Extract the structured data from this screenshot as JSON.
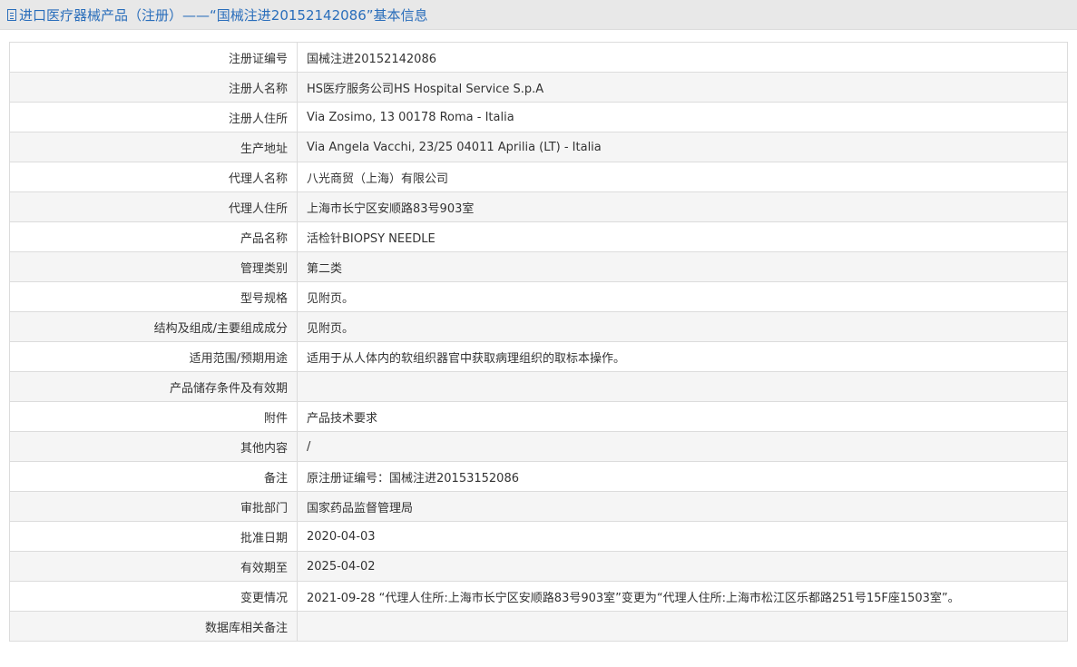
{
  "page": {
    "title": "进口医疗器械产品（注册）——“国械注进20152142086”基本信息"
  },
  "rows": [
    {
      "label": "注册证编号",
      "value": "国械注进20152142086"
    },
    {
      "label": "注册人名称",
      "value": "HS医疗服务公司HS Hospital Service S.p.A"
    },
    {
      "label": "注册人住所",
      "value": "Via Zosimo, 13 00178 Roma - Italia"
    },
    {
      "label": "生产地址",
      "value": "Via Angela Vacchi, 23/25 04011 Aprilia (LT) - Italia"
    },
    {
      "label": "代理人名称",
      "value": "八光商贸（上海）有限公司"
    },
    {
      "label": "代理人住所",
      "value": "上海市长宁区安顺路83号903室"
    },
    {
      "label": "产品名称",
      "value": "活检针BIOPSY NEEDLE"
    },
    {
      "label": "管理类别",
      "value": "第二类"
    },
    {
      "label": "型号规格",
      "value": "见附页。"
    },
    {
      "label": "结构及组成/主要组成成分",
      "value": "见附页。"
    },
    {
      "label": "适用范围/预期用途",
      "value": "适用于从人体内的软组织器官中获取病理组织的取标本操作。"
    },
    {
      "label": "产品储存条件及有效期",
      "value": ""
    },
    {
      "label": "附件",
      "value": "产品技术要求"
    },
    {
      "label": "其他内容",
      "value": "/"
    },
    {
      "label": "备注",
      "value": "原注册证编号：国械注进20153152086"
    },
    {
      "label": "审批部门",
      "value": "国家药品监督管理局"
    },
    {
      "label": "批准日期",
      "value": "2020-04-03"
    },
    {
      "label": "有效期至",
      "value": "2025-04-02"
    },
    {
      "label": "变更情况",
      "value": "2021-09-28 “代理人住所:上海市长宁区安顺路83号903室”变更为“代理人住所:上海市松江区乐都路251号15F座1503室”。"
    },
    {
      "label": "数据库相关备注",
      "value": ""
    }
  ],
  "icons": {
    "title_icon": "document-icon"
  },
  "colors": {
    "title_text": "#2a6ebb",
    "title_bar_bg": "#e8e8e8",
    "row_alt_bg": "#f5f5f5",
    "border": "#dcdcdc"
  }
}
